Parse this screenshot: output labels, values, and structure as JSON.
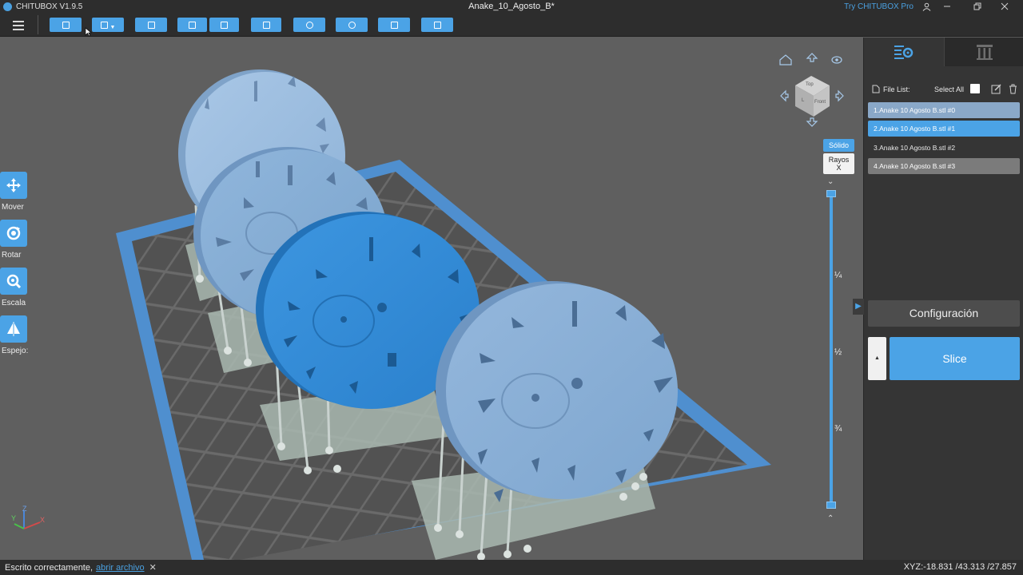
{
  "app": {
    "name": "CHITUBOX V1.9.5",
    "document_title": "Anake_10_Agosto_B*",
    "try_pro": "Try CHITUBOX Pro"
  },
  "toolbar": {
    "buttons": [
      "open-file",
      "save",
      "import",
      "undo",
      "redo",
      "copy",
      "auto-layout",
      "hollow",
      "dig-hole",
      "repair"
    ]
  },
  "left_tools": {
    "move": "Mover",
    "rotate": "Rotar",
    "scale": "Escala",
    "mirror": "Espejo:"
  },
  "viewcube": {
    "top": "Top",
    "front": "Front",
    "left": "L"
  },
  "render_mode": {
    "solid": "Sólido",
    "xray": "Rayos X"
  },
  "layer_slider": {
    "ticks": [
      "¼",
      "½",
      "¾"
    ],
    "top_value": 1,
    "bottom_value": 0
  },
  "axes": {
    "x": "X",
    "y": "Y",
    "z": "Z"
  },
  "right_panel": {
    "file_list_label": "File List:",
    "select_all_label": "Select All",
    "files": [
      "1.Anake 10 Agosto B.stl #0",
      "2.Anake 10 Agosto B.stl #1",
      "3.Anake 10 Agosto B.stl #2",
      "4.Anake 10 Agosto B.stl #3"
    ],
    "selected_index": 1,
    "config_label": "Configuración",
    "slice_label": "Slice"
  },
  "status": {
    "message": "Escrito correctamente,",
    "link": "abrir archivo",
    "close": "✕",
    "xyz": "XYZ:-18.831 /43.313 /27.857"
  },
  "colors": {
    "accent": "#4ba3e6",
    "background": "#5f5f5f",
    "panel": "#353535",
    "bar": "#2d2d2d"
  }
}
